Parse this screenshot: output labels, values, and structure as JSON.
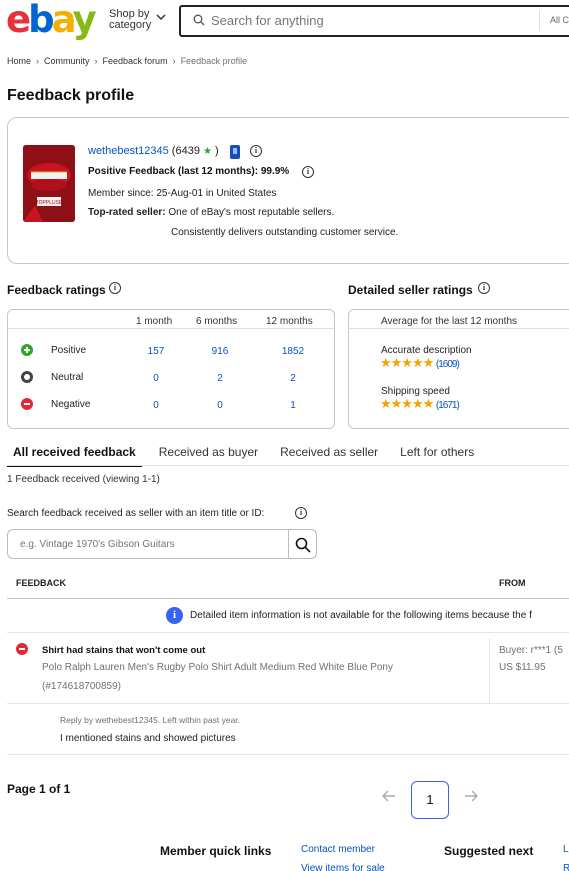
{
  "header": {
    "shop_by_line1": "Shop by",
    "shop_by_line2": "category",
    "search_placeholder": "Search for anything",
    "category_select": "All C"
  },
  "breadcrumb": [
    "Home",
    "Community",
    "Feedback forum",
    "Feedback profile"
  ],
  "page_title": "Feedback profile",
  "profile": {
    "username": "wethebest12345",
    "score_open": "(6439",
    "score_close": ")",
    "positive_feedback": "Positive Feedback (last 12 months): 99.9%",
    "member_since": "Member since: 25-Aug-01 in United States",
    "top_rated_label": "Top-rated seller:",
    "top_rated_text": "One of eBay's most reputable sellers.",
    "top_rated_text_2": "Consistently delivers outstanding customer service.",
    "avatar_label": "TOPPLUSE"
  },
  "feedback_ratings": {
    "title": "Feedback ratings",
    "columns": [
      "1 month",
      "6 months",
      "12 months"
    ],
    "rows": [
      {
        "label": "Positive",
        "values": [
          "157",
          "916",
          "1852"
        ]
      },
      {
        "label": "Neutral",
        "values": [
          "0",
          "2",
          "2"
        ]
      },
      {
        "label": "Negative",
        "values": [
          "0",
          "0",
          "1"
        ]
      }
    ]
  },
  "detailed_seller_ratings": {
    "title": "Detailed seller ratings",
    "subtitle": "Average for the last 12 months",
    "items": [
      {
        "label": "Accurate description",
        "stars": 5,
        "count": "(1609)"
      },
      {
        "label": "Shipping speed",
        "stars": 5,
        "count": "(1671)"
      }
    ]
  },
  "tabs": [
    "All received feedback",
    "Received as buyer",
    "Received as seller",
    "Left for others"
  ],
  "feedback_received": "1 Feedback received (viewing 1-1)",
  "search": {
    "label": "Search feedback received as seller with an item title or ID:",
    "placeholder": "e.g. Vintage 1970's Gibson Guitars"
  },
  "table": {
    "col_feedback": "FEEDBACK",
    "col_from": "FROM",
    "notice": "Detailed item information is not available for the following items because the f",
    "rows": [
      {
        "rating": "negative",
        "comment": "Shirt had stains that won't come out",
        "item_title": "Polo Ralph Lauren Men's Rugby Polo Shirt Adult Medium Red White Blue Pony",
        "item_number": "(#174618700859)",
        "buyer": "Buyer: r***1 (5",
        "price": "US $11.95",
        "reply_meta": "Reply by wethebest12345. Left within past year.",
        "reply_text": "I mentioned stains and showed pictures"
      }
    ]
  },
  "pagination": {
    "label": "Page 1 of 1",
    "current": "1"
  },
  "footer": {
    "member_quick_links": "Member quick links",
    "contact_member": "Contact member",
    "view_items": "View items for sale",
    "suggested_next": "Suggested next",
    "edge_link_1": "L",
    "edge_link_2": "R"
  },
  "colors": {
    "brand_red": "#e53238",
    "brand_blue": "#0064d2",
    "brand_yellow": "#f5af02",
    "brand_green": "#86b817",
    "link": "#0654ba",
    "accent": "#3665f3"
  }
}
